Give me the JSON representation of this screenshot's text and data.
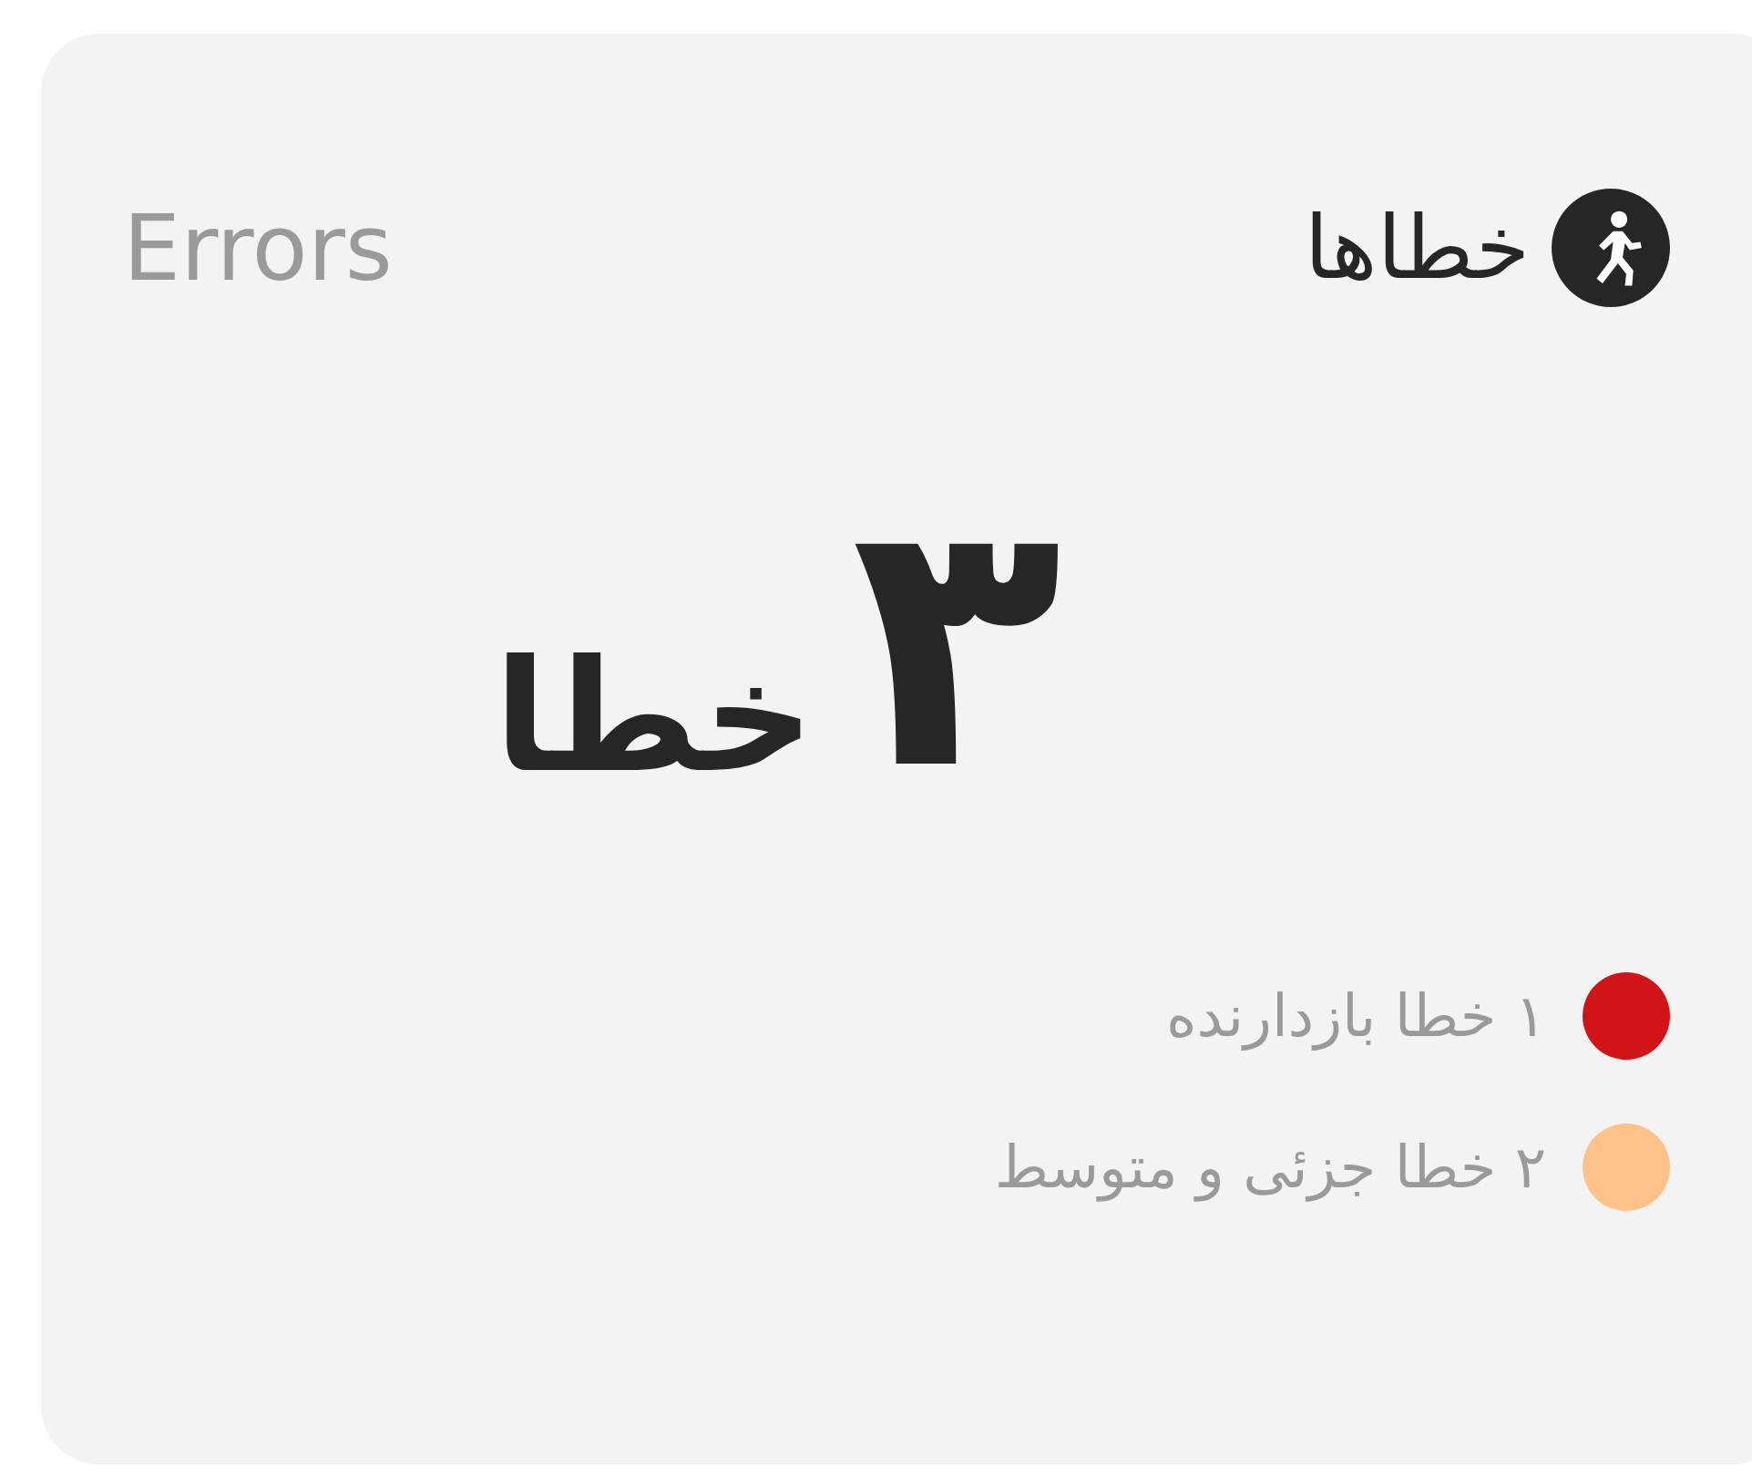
{
  "card": {
    "title": "خطاها",
    "subtitle": "Errors",
    "count": "۳",
    "unit": "خطا",
    "legend": [
      {
        "label": "۱ خطا بازدارنده",
        "color": "#d01418"
      },
      {
        "label": "۲ خطا جزئی و متوسط",
        "color": "#ffc18a"
      }
    ]
  }
}
